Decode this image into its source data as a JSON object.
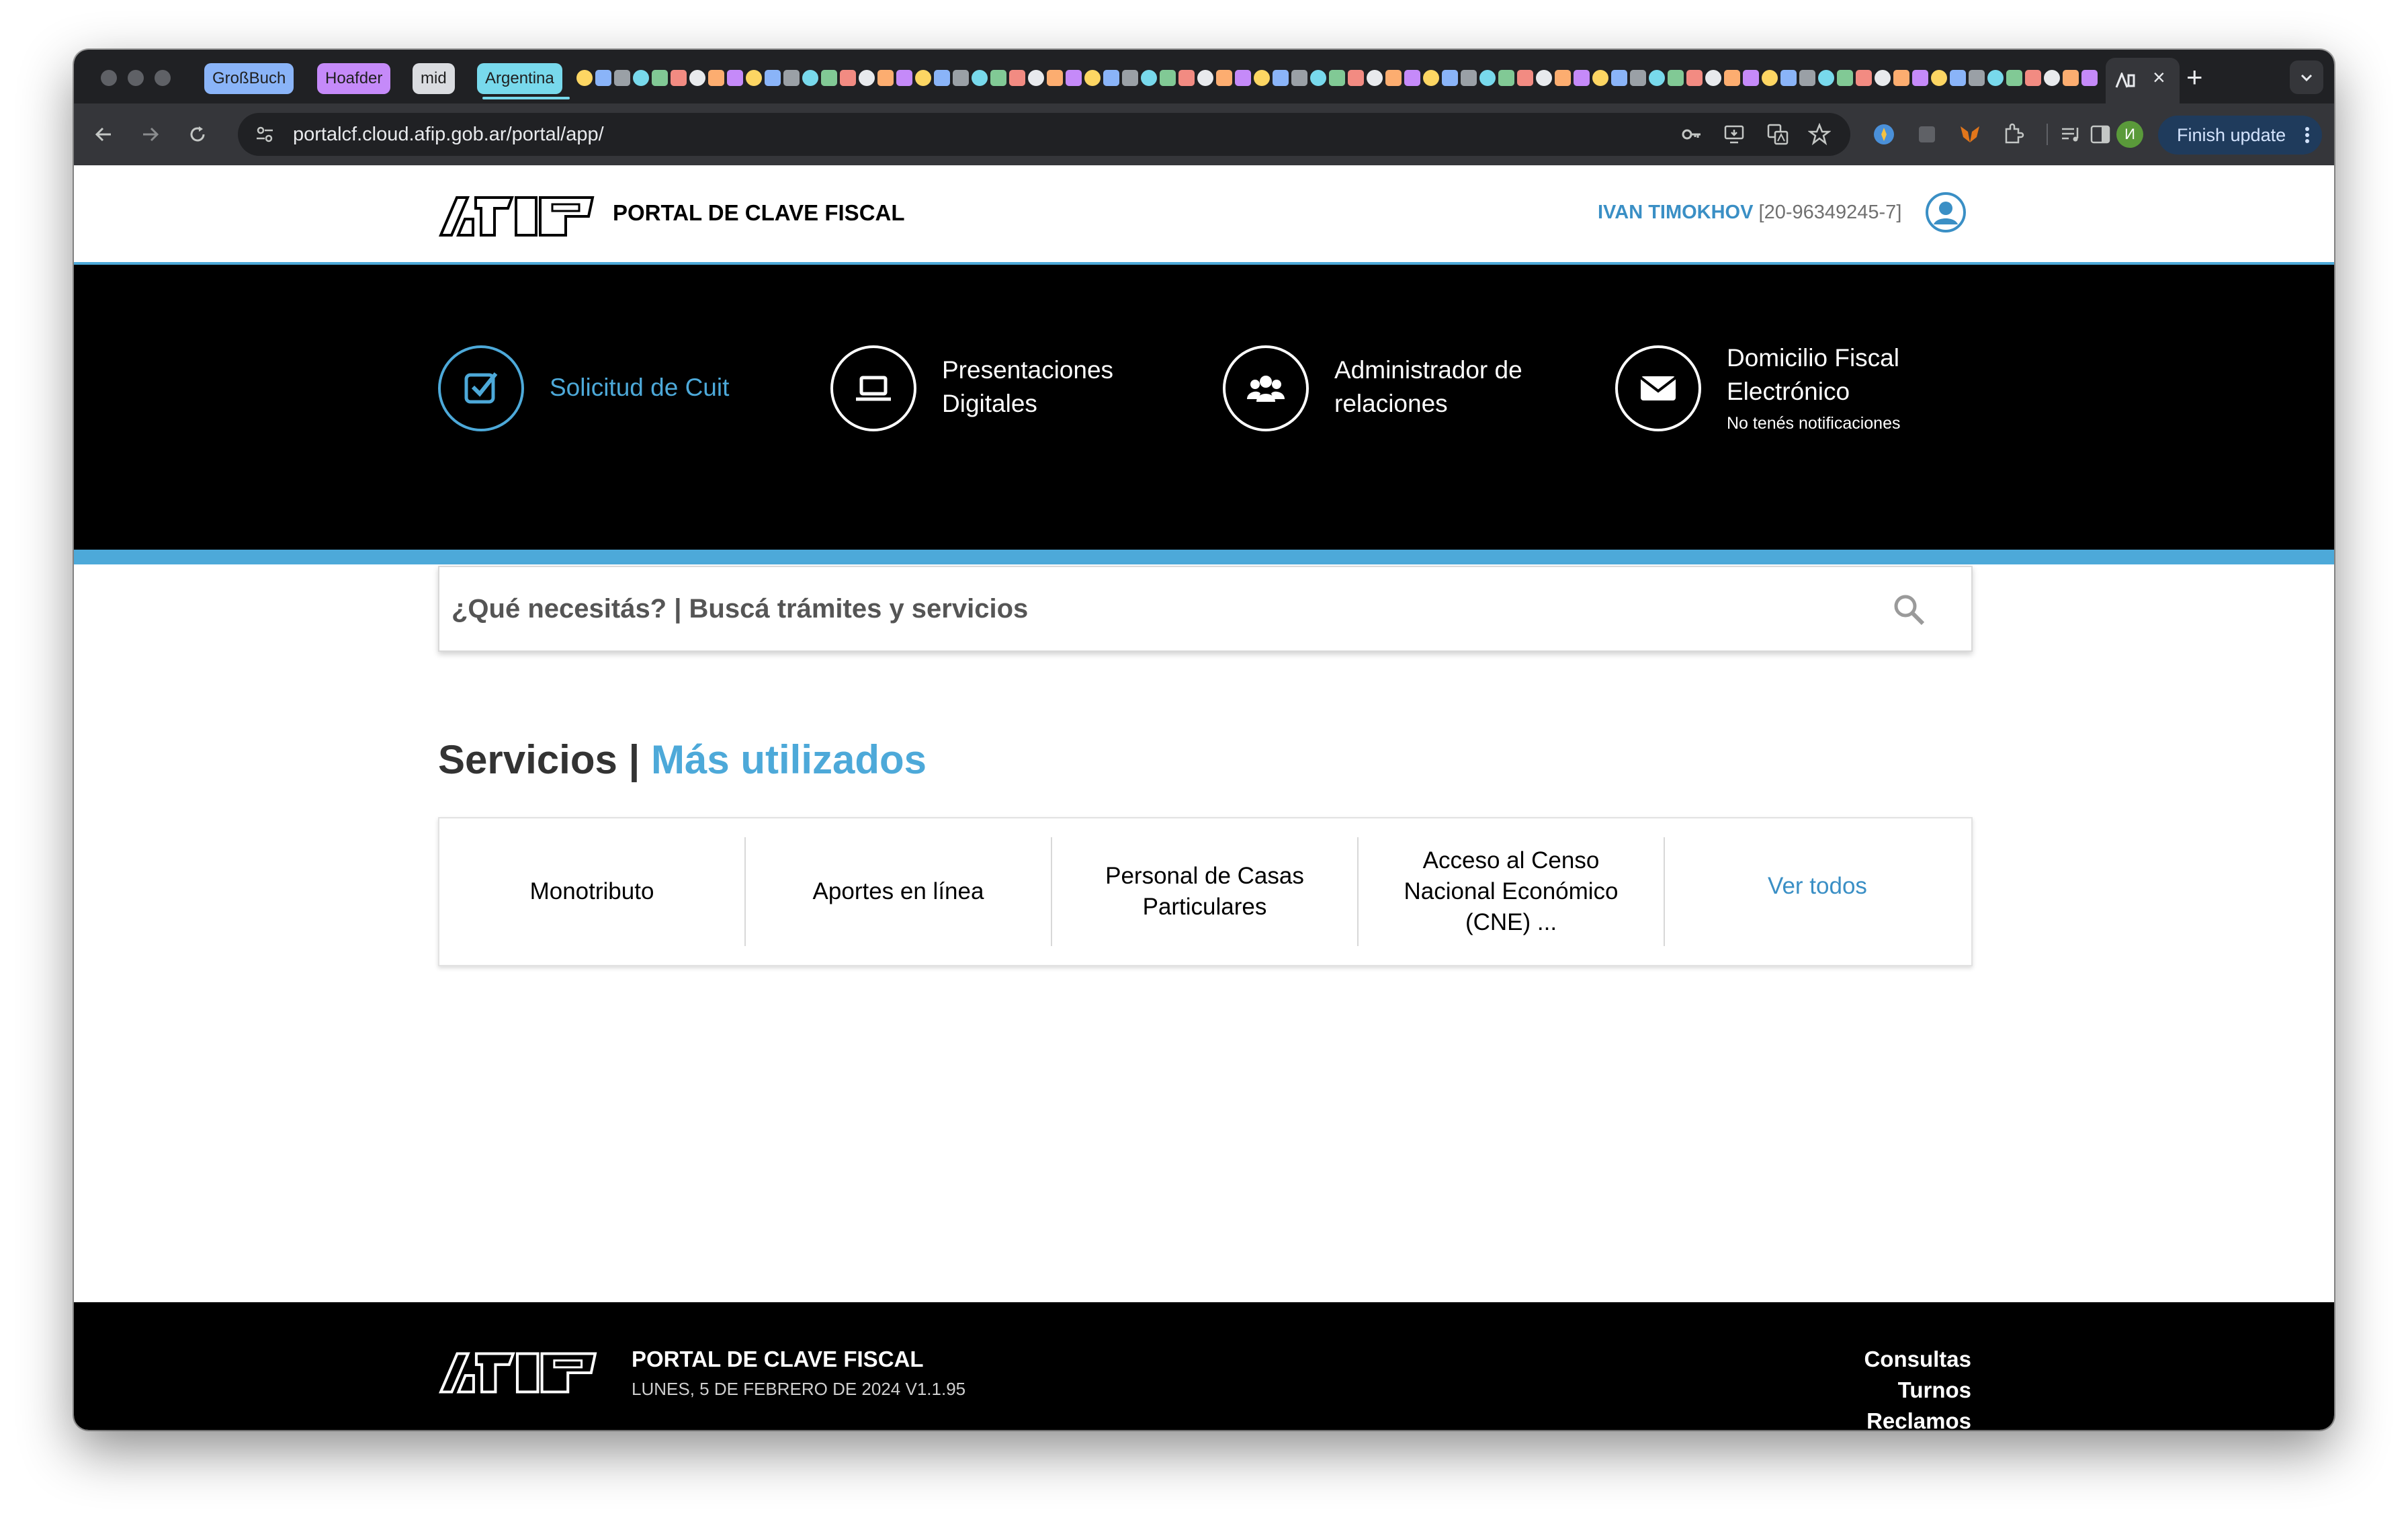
{
  "browser": {
    "tab_groups": [
      {
        "label": "GroßBuch",
        "color": "#8ab4f8"
      },
      {
        "label": "Hoafder",
        "color": "#c58af9"
      },
      {
        "label": "mid",
        "color": "#dadce0"
      },
      {
        "label": "Argentina",
        "color": "#78d9ec"
      }
    ],
    "new_tab_symbol": "+",
    "close_tab_symbol": "×",
    "url": "portalcf.cloud.afip.gob.ar/portal/app/",
    "profile_initial": "И",
    "finish_update_label": "Finish update"
  },
  "header": {
    "brand_title": "PORTAL DE CLAVE FISCAL",
    "user_name": "IVAN TIMOKHOV",
    "user_cuit": "[20-96349245-7]"
  },
  "quick_access": {
    "items": [
      {
        "label": "Solicitud de Cuit",
        "icon": "checkbox-icon"
      },
      {
        "label_line1": "Presentaciones",
        "label_line2": "Digitales",
        "icon": "laptop-icon"
      },
      {
        "label_line1": "Administrador de",
        "label_line2": "relaciones",
        "icon": "users-icon"
      },
      {
        "label_line1": "Domicilio Fiscal",
        "label_line2": "Electrónico",
        "sublabel": "No tenés notificaciones",
        "icon": "envelope-icon"
      }
    ]
  },
  "search": {
    "placeholder": "¿Qué necesitás? | Buscá trámites y servicios"
  },
  "services": {
    "title": "Servicios |",
    "title_accent": "Más utilizados",
    "items": [
      {
        "line1": "Monotributo"
      },
      {
        "line1": "Aportes en línea"
      },
      {
        "line1": "Personal de Casas",
        "line2": "Particulares"
      },
      {
        "line1": "Acceso al Censo",
        "line2": "Nacional Económico",
        "line3": "(CNE) ..."
      }
    ],
    "see_all": "Ver todos"
  },
  "footer": {
    "title": "PORTAL DE CLAVE FISCAL",
    "date_version": "LUNES, 5 DE FEBRERO DE 2024 V1.1.95",
    "links": [
      "Consultas",
      "Turnos",
      "Reclamos"
    ]
  },
  "colors": {
    "accent": "#4da9d9",
    "hero_background": "#000000",
    "link": "#3a8fc5"
  }
}
